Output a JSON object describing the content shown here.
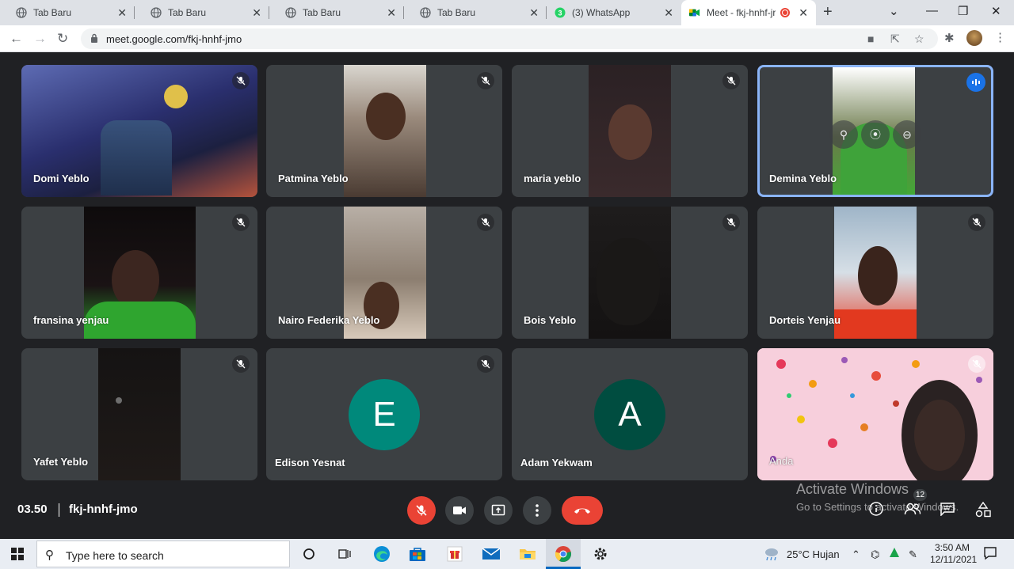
{
  "browser": {
    "tabs": [
      {
        "title": "Tab Baru"
      },
      {
        "title": "Tab Baru"
      },
      {
        "title": "Tab Baru"
      },
      {
        "title": "Tab Baru"
      },
      {
        "title": "(3) WhatsApp",
        "badge": "3"
      },
      {
        "title": "Meet - fkj-hnhf-jr"
      }
    ],
    "url": "meet.google.com/fkj-hnhf-jmo"
  },
  "participants": [
    {
      "name": "Domi Yeblo",
      "muted": true
    },
    {
      "name": "Patmina Yeblo",
      "muted": true
    },
    {
      "name": "maria yeblo",
      "muted": true
    },
    {
      "name": "Demina Yeblo",
      "muted": false,
      "speaking": true
    },
    {
      "name": "fransina yenjau",
      "muted": true
    },
    {
      "name": "Nairo Federika Yeblo",
      "muted": true
    },
    {
      "name": "Bois Yeblo",
      "muted": true
    },
    {
      "name": "Dorteis Yenjau",
      "muted": true
    },
    {
      "name": "Yafet Yeblo",
      "muted": true
    },
    {
      "name": "Edison Yesnat",
      "muted": true,
      "initial": "E",
      "avatar_color": "#00897b"
    },
    {
      "name": "Adam Yekwam",
      "muted": false,
      "initial": "A",
      "avatar_color": "#004d40"
    },
    {
      "name": "Anda",
      "muted": true
    }
  ],
  "meeting": {
    "time": "03.50",
    "code": "fkj-hnhf-jmo",
    "participant_count": "12"
  },
  "watermark": {
    "line1": "Activate Windows",
    "line2": "Go to Settings to activate Windows."
  },
  "taskbar": {
    "search_placeholder": "Type here to search",
    "weather": "25°C Hujan",
    "time": "3:50 AM",
    "date": "12/11/2021"
  },
  "colors": {
    "end_call": "#ea4335",
    "speaking_border": "#8ab4f8",
    "background": "#202124",
    "tile": "#3c4043"
  }
}
